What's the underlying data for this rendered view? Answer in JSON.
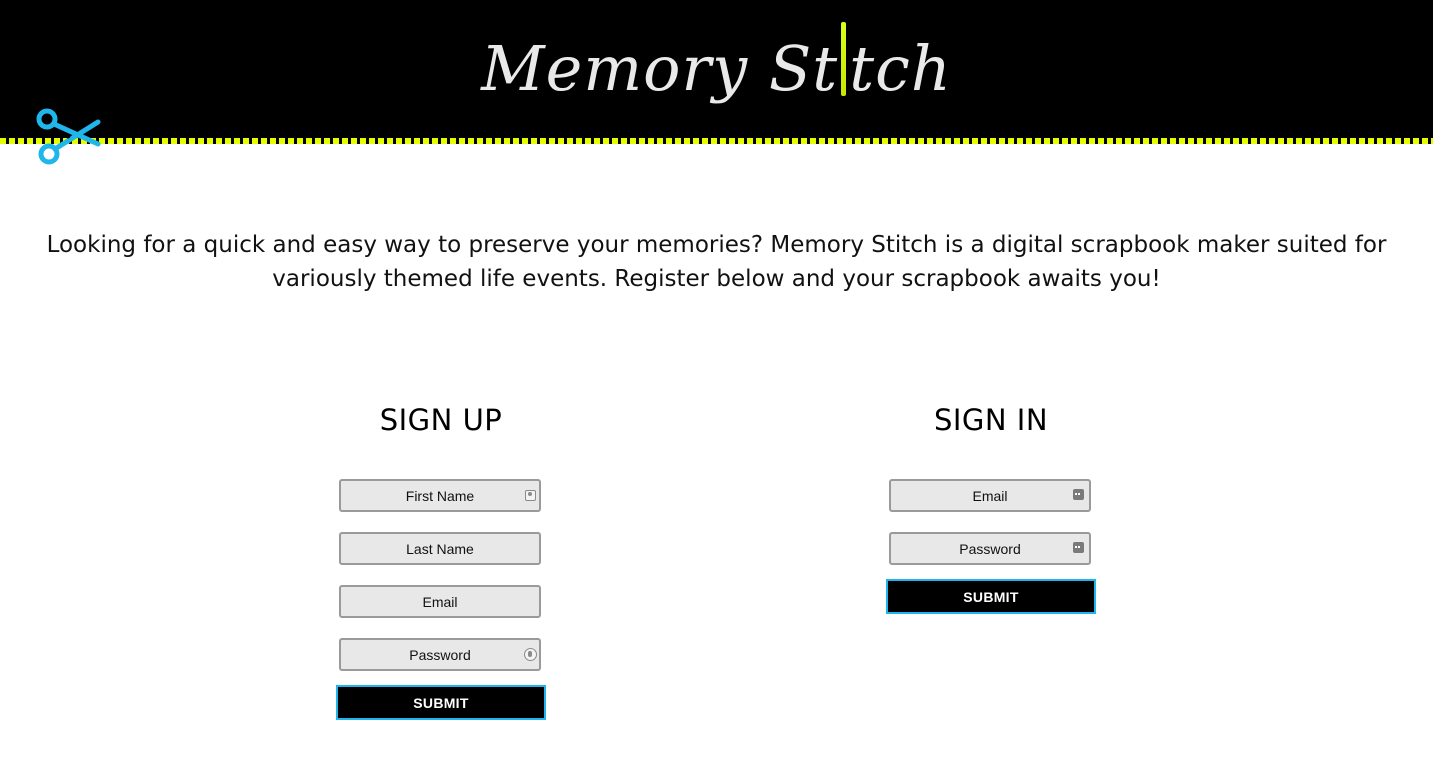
{
  "header": {
    "logo_text_left": "Memory St",
    "logo_text_right": "tch",
    "colors": {
      "background": "#000000",
      "stitch": "#e6ff00",
      "scissors": "#1fb6ec",
      "logo_text": "#e9e9e9"
    },
    "icons": [
      "scissors-icon",
      "needle-icon"
    ]
  },
  "intro": {
    "text": "Looking for a quick and easy way to preserve your memories? Memory Stitch is a digital scrapbook maker suited for variously themed life events. Register below and your scrapbook awaits you!"
  },
  "signup": {
    "title": "SIGN UP",
    "first_name_placeholder": "First Name",
    "last_name_placeholder": "Last Name",
    "email_placeholder": "Email",
    "password_placeholder": "Password",
    "submit_label": "SUBMIT"
  },
  "signin": {
    "title": "SIGN IN",
    "email_placeholder": "Email",
    "password_placeholder": "Password",
    "submit_label": "SUBMIT"
  }
}
